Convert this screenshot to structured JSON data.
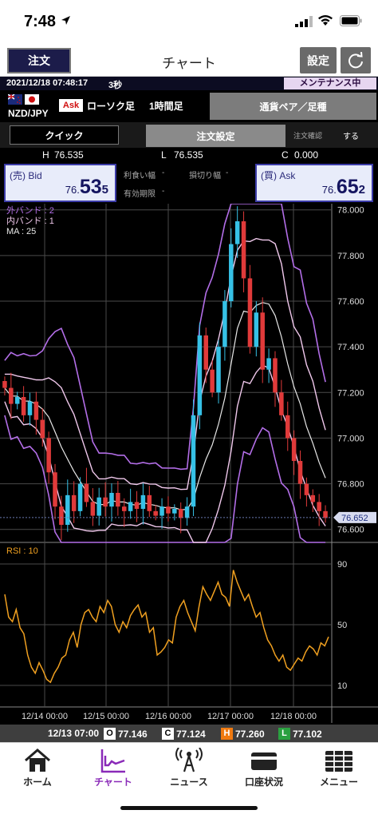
{
  "status": {
    "time": "7:48"
  },
  "nav": {
    "order": "注文",
    "title": "チャート",
    "settings": "設定",
    "refresh_icon": "refresh-icon"
  },
  "info": {
    "datetime": "2021/12/18 07:48:17",
    "interval": "3秒",
    "maintenance": "メンテナンス中"
  },
  "pair": {
    "label": "NZD/JPY",
    "ask_badge": "Ask",
    "candle_type": "ローソク足",
    "period": "1時間足",
    "pair_button": "通貨ペア／足種"
  },
  "order_tabs": {
    "quick": "クイック",
    "order_settings": "注文設定",
    "confirm": "注文確認",
    "do": "する"
  },
  "hlc": {
    "h_label": "H",
    "h": "76.535",
    "l_label": "L",
    "l": "76.535",
    "c_label": "C",
    "c": "0.000"
  },
  "bid": {
    "label": "(売) Bid",
    "small": "76.",
    "big": "53",
    "pip": "5"
  },
  "ask": {
    "label": "(買) Ask",
    "small": "76.",
    "big": "65",
    "pip": "2"
  },
  "mid": {
    "take_profit": "利食い幅",
    "take_profit_val": "-",
    "stop_loss": "損切り幅",
    "stop_loss_val": "-",
    "expiry": "有効期限",
    "expiry_val": "-"
  },
  "chart_data": [
    {
      "type": "candlestick",
      "indicators": [
        "外バンド : 2",
        "内バンド : 1",
        "MA : 25"
      ],
      "y_ticks": [
        "78.000",
        "77.800",
        "77.600",
        "77.400",
        "77.200",
        "77.000",
        "76.800",
        "76.600"
      ],
      "ylim": [
        76.55,
        78.02
      ],
      "x_ticks": [
        "12/14 00:00",
        "12/15 00:00",
        "12/16 00:00",
        "12/17 00:00",
        "12/18 00:00"
      ],
      "current_price": "76.652",
      "colors": {
        "up": "#36c1e6",
        "down": "#e03a3a",
        "outer_band": "#b36ee8",
        "inner_band": "#f0c8ec",
        "ma": "#e8e8e8"
      },
      "close_approx": [
        77.22,
        77.15,
        77.18,
        77.1,
        77.16,
        77.08,
        77.0,
        76.85,
        76.7,
        76.62,
        76.75,
        76.68,
        76.8,
        76.72,
        76.66,
        76.74,
        76.7,
        76.76,
        76.7,
        76.68,
        76.72,
        76.69,
        76.75,
        76.68,
        76.66,
        76.7,
        76.67,
        76.69,
        76.65,
        76.7,
        77.1,
        77.45,
        77.3,
        77.2,
        77.4,
        77.6,
        77.85,
        77.95,
        77.7,
        77.4,
        77.55,
        77.3,
        77.35,
        77.2,
        77.1,
        77.0,
        76.9,
        76.8,
        76.75,
        76.72,
        76.68,
        76.65
      ]
    },
    {
      "type": "line",
      "title": "RSI : 10",
      "y_ticks": [
        "90",
        "50",
        "10"
      ],
      "ylim": [
        0,
        100
      ],
      "color": "#f0a020",
      "values": [
        70,
        55,
        52,
        60,
        48,
        44,
        30,
        22,
        18,
        25,
        20,
        14,
        12,
        18,
        22,
        28,
        30,
        40,
        45,
        35,
        50,
        58,
        60,
        55,
        52,
        62,
        58,
        66,
        62,
        50,
        45,
        52,
        48,
        56,
        60,
        63,
        55,
        58,
        45,
        48,
        30,
        32,
        35,
        40,
        38,
        55,
        62,
        66,
        58,
        52,
        46,
        62,
        75,
        70,
        66,
        72,
        78,
        70,
        68,
        62,
        86,
        78,
        72,
        66,
        70,
        62,
        55,
        58,
        48,
        40,
        36,
        30,
        26,
        30,
        22,
        20,
        24,
        28,
        26,
        32,
        36,
        34,
        30,
        38,
        36,
        42
      ]
    }
  ],
  "ohlc": {
    "time": "12/13 07:00",
    "o_label": "O",
    "o": "77.146",
    "c_label": "C",
    "c": "77.124",
    "h_label": "H",
    "h": "77.260",
    "l_label": "L",
    "l": "77.102"
  },
  "tabs": [
    {
      "label": "ホーム",
      "icon": "home-icon"
    },
    {
      "label": "チャート",
      "icon": "chart-icon"
    },
    {
      "label": "ニュース",
      "icon": "news-icon"
    },
    {
      "label": "口座状況",
      "icon": "account-icon"
    },
    {
      "label": "メニュー",
      "icon": "menu-icon"
    }
  ]
}
